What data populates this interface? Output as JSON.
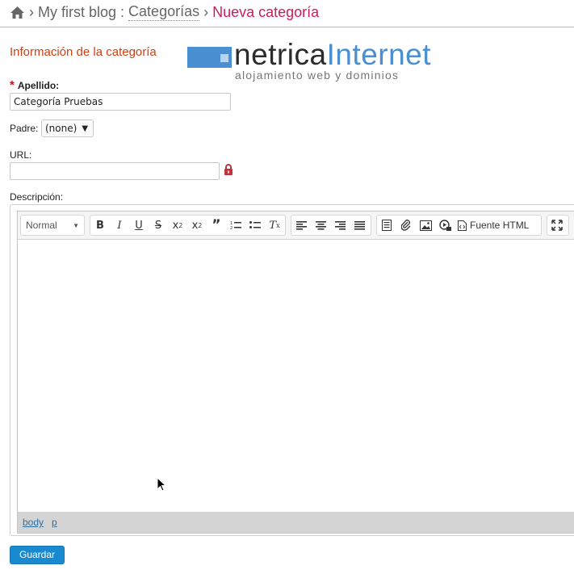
{
  "breadcrumb": {
    "home_icon": "home-icon",
    "separator": "›",
    "blog": "My first blog",
    "colon": ":",
    "section": "Categorías",
    "current": "Nueva categoría"
  },
  "section_title": "Información de la categoría",
  "logo": {
    "word_dark": "netrica",
    "word_blue": "Internet",
    "tagline": "alojamiento web y dominios",
    "brand_color": "#4a8fd1"
  },
  "form": {
    "required_mark": "*",
    "apellido_label": "Apellido:",
    "apellido_value": "Categoría Pruebas",
    "padre_label": "Padre:",
    "padre_selected": "(none)",
    "url_label": "URL:",
    "url_value": "",
    "descripcion_label": "Descripción:"
  },
  "editor": {
    "format_value": "Normal",
    "source_label": "Fuente HTML",
    "path": [
      "body",
      "p"
    ]
  },
  "save_label": "Guardar",
  "colors": {
    "accent": "#d0195d",
    "section_title": "#d03f14",
    "button": "#1a8ad0",
    "link": "#2e6ea3"
  }
}
